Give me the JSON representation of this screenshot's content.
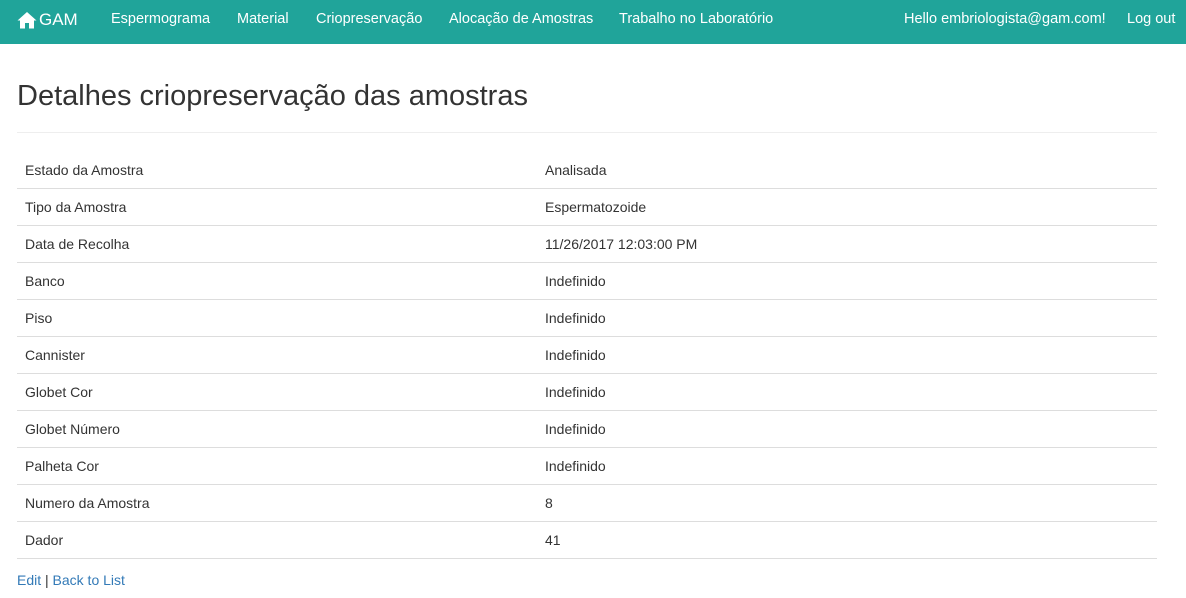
{
  "navbar": {
    "brand": "GAM",
    "brand_icon": "home-icon",
    "bg_color": "#20a49a",
    "items": [
      {
        "label": "Espermograma"
      },
      {
        "label": "Material"
      },
      {
        "label": "Criopreservação"
      },
      {
        "label": "Alocação de Amostras"
      },
      {
        "label": "Trabalho no Laboratório"
      }
    ],
    "greeting": "Hello embriologista@gam.com!",
    "logout": "Log out"
  },
  "page": {
    "title": "Detalhes criopreservação das amostras"
  },
  "details": [
    {
      "label": "Estado da Amostra",
      "value": "Analisada"
    },
    {
      "label": "Tipo da Amostra",
      "value": "Espermatozoide"
    },
    {
      "label": "Data de Recolha",
      "value": "11/26/2017 12:03:00 PM"
    },
    {
      "label": "Banco",
      "value": "Indefinido"
    },
    {
      "label": "Piso",
      "value": "Indefinido"
    },
    {
      "label": "Cannister",
      "value": "Indefinido"
    },
    {
      "label": "Globet Cor",
      "value": "Indefinido"
    },
    {
      "label": "Globet Número",
      "value": "Indefinido"
    },
    {
      "label": "Palheta Cor",
      "value": "Indefinido"
    },
    {
      "label": "Numero da Amostra",
      "value": "8"
    },
    {
      "label": "Dador",
      "value": "41"
    }
  ],
  "links": {
    "edit": "Edit",
    "separator": "|",
    "back": "Back to List",
    "link_color": "#337ab7"
  }
}
